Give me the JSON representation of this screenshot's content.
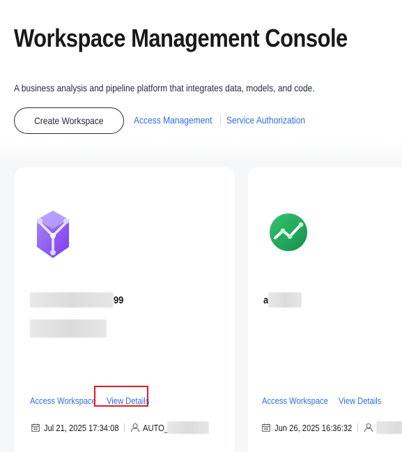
{
  "header": {
    "title": "Workspace Management Console",
    "subtitle": "A business analysis and pipeline platform that integrates data, models, and code."
  },
  "actions": {
    "create_label": "Create Workspace",
    "access_management_label": "Access Management",
    "service_authorization_label": "Service Authorization"
  },
  "workspaces": [
    {
      "name_visible_suffix": "99",
      "icon": "cube-icon",
      "icon_color": "#8b5cf6",
      "access_label": "Access Workspace",
      "details_label": "View Details",
      "created": "Jul 21, 2025 17:34:08",
      "owner_visible": "AUTO_"
    },
    {
      "name_visible_prefix": "a",
      "icon": "trend-chart-icon",
      "icon_color": "#22a45a",
      "access_label": "Access Workspace",
      "details_label": "View Details",
      "created": "Jun 26, 2025 16:36:32",
      "owner_visible": ""
    }
  ],
  "colors": {
    "link": "#2e6ee0",
    "highlight": "#e01b24",
    "card_bg": "#ffffff",
    "page_bg": "#f6f7f9"
  }
}
